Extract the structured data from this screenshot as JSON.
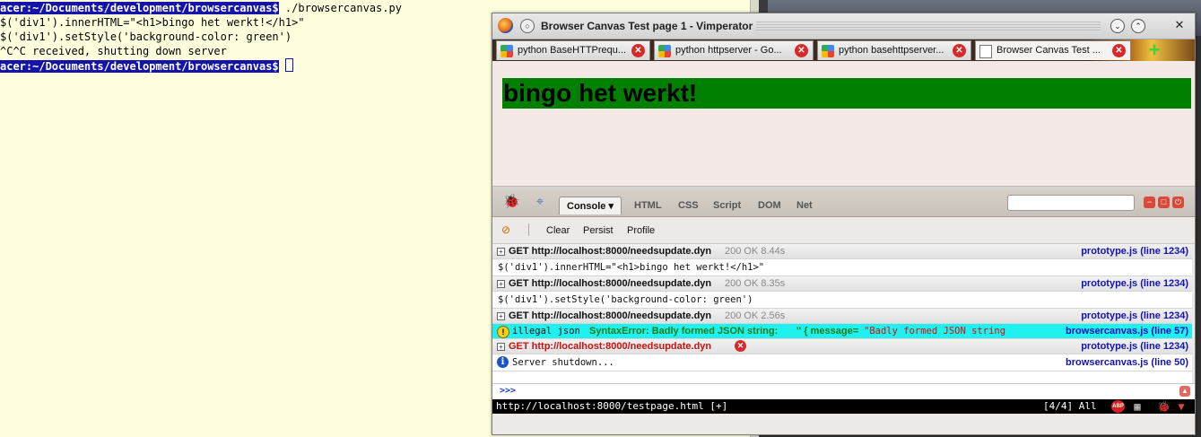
{
  "terminal": {
    "prompt1": "acer:~/Documents/development/browsercanvas$",
    "cmd1": " ./browsercanvas.py",
    "line2": "$('div1').innerHTML=\"<h1>bingo het werkt!</h1>\"",
    "line3": "$('div1').setStyle('background-color: green')",
    "line4": "^C^C received, shutting down server",
    "prompt2": "acer:~/Documents/development/browsercanvas$"
  },
  "window": {
    "title": "Browser Canvas Test page 1 - Vimperator",
    "menu_glyph": "○",
    "min_glyph": "⌄",
    "max_glyph": "⌃",
    "close_glyph": "✕"
  },
  "tabs": [
    {
      "label": "python BaseHTTPrequ...",
      "icon": "google-icon"
    },
    {
      "label": "python httpserver - Go...",
      "icon": "google-icon"
    },
    {
      "label": "python basehttpserver...",
      "icon": "google-icon"
    },
    {
      "label": "Browser Canvas Test ...",
      "icon": "page-icon"
    }
  ],
  "tab_close_glyph": "✕",
  "new_tab_glyph": "+",
  "page": {
    "heading": "bingo het werkt!",
    "div_color": "#008000",
    "bg_color": "#f3e9e7"
  },
  "firebug": {
    "tabs": [
      "Console ▾",
      "HTML",
      "CSS",
      "Script",
      "DOM",
      "Net"
    ],
    "console_buttons": [
      "Clear",
      "Persist",
      "Profile"
    ],
    "search_placeholder": "",
    "win_glyphs": [
      "−",
      "□",
      "⏻"
    ],
    "log": [
      {
        "kind": "request",
        "url": "GET http://localhost:8000/needsupdate.dyn",
        "status": "200 OK 8.44s",
        "source": "prototype.js (line 1234)"
      },
      {
        "kind": "output",
        "text": "$('div1').innerHTML=\"<h1>bingo het werkt!</h1>\""
      },
      {
        "kind": "request",
        "url": "GET http://localhost:8000/needsupdate.dyn",
        "status": "200 OK 8.35s",
        "source": "prototype.js (line 1234)"
      },
      {
        "kind": "output",
        "text": "$('div1').setStyle('background-color: green')"
      },
      {
        "kind": "request",
        "url": "GET http://localhost:8000/needsupdate.dyn",
        "status": "200 OK 2.56s",
        "source": "prototype.js (line 1234)"
      },
      {
        "kind": "error",
        "label": "illegal json",
        "text": "SyntaxError: Badly formed JSON string: ",
        "obj": "'' { message=",
        "msg": "\"Badly formed JSON string",
        "source": "browsercanvas.js (line 57)"
      },
      {
        "kind": "request-error",
        "url": "GET http://localhost:8000/needsupdate.dyn",
        "source": "prototype.js (line 1234)"
      },
      {
        "kind": "info",
        "text": "Server shutdown...",
        "source": "browsercanvas.js (line 50)"
      }
    ],
    "cmd_prompt": ">>>"
  },
  "statusbar": {
    "url": "http://localhost:8000/testpage.html [+]",
    "position": "[4/4] All",
    "abp": "ABP"
  }
}
